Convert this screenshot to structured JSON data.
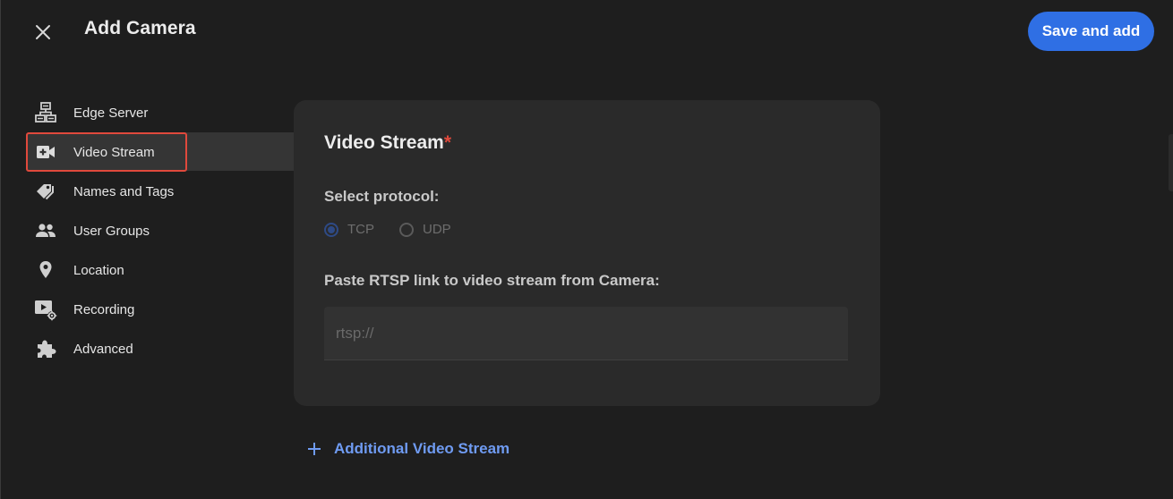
{
  "header": {
    "title": "Add Camera",
    "save_label": "Save and add",
    "close_icon": "close-icon"
  },
  "sidebar": {
    "active_index": 1,
    "items": [
      {
        "label": "Edge Server",
        "icon": "server-icon"
      },
      {
        "label": "Video Stream",
        "icon": "video-camera-add-icon"
      },
      {
        "label": "Names and Tags",
        "icon": "tags-icon"
      },
      {
        "label": "User Groups",
        "icon": "people-icon"
      },
      {
        "label": "Location",
        "icon": "location-pin-icon"
      },
      {
        "label": "Recording",
        "icon": "recording-settings-icon"
      },
      {
        "label": "Advanced",
        "icon": "puzzle-icon"
      }
    ]
  },
  "card": {
    "title": "Video Stream",
    "required_mark": "*",
    "protocol_label": "Select protocol:",
    "protocols": [
      {
        "label": "TCP",
        "checked": true
      },
      {
        "label": "UDP",
        "checked": false
      }
    ],
    "rtsp_label": "Paste RTSP link to video stream from Camera:",
    "rtsp_placeholder": "rtsp://",
    "rtsp_value": ""
  },
  "additional": {
    "label": "Additional Video Stream"
  },
  "colors": {
    "accent": "#2f6fe4",
    "link": "#6f9bf2",
    "required": "#e0493c",
    "background": "#1e1e1e",
    "card": "#2a2a2a"
  }
}
